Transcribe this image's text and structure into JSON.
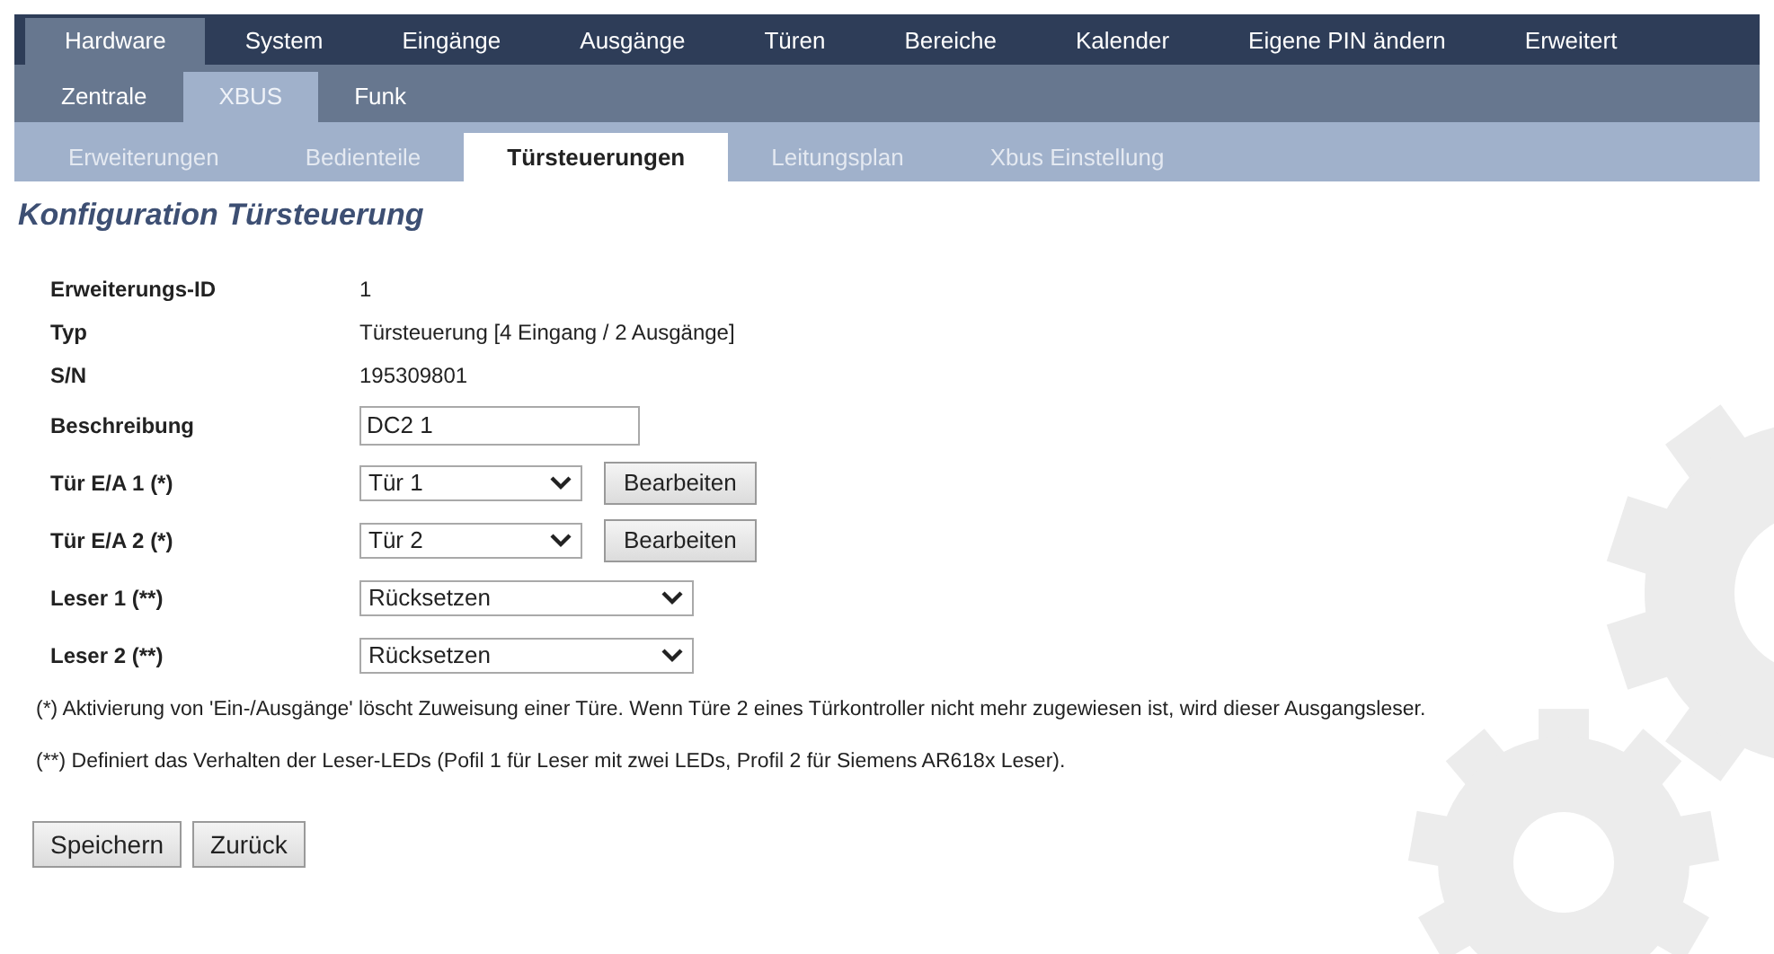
{
  "nav_main": [
    {
      "label": "Hardware",
      "selected": true
    },
    {
      "label": "System",
      "selected": false
    },
    {
      "label": "Eingänge",
      "selected": false
    },
    {
      "label": "Ausgänge",
      "selected": false
    },
    {
      "label": "Türen",
      "selected": false
    },
    {
      "label": "Bereiche",
      "selected": false
    },
    {
      "label": "Kalender",
      "selected": false
    },
    {
      "label": "Eigene PIN ändern",
      "selected": false
    },
    {
      "label": "Erweitert",
      "selected": false
    }
  ],
  "nav_sub": [
    {
      "label": "Zentrale",
      "selected": false
    },
    {
      "label": "XBUS",
      "selected": true
    },
    {
      "label": "Funk",
      "selected": false
    }
  ],
  "nav_tabs": [
    {
      "label": "Erweiterungen",
      "selected": false
    },
    {
      "label": "Bedienteile",
      "selected": false
    },
    {
      "label": "Türsteuerungen",
      "selected": true
    },
    {
      "label": "Leitungsplan",
      "selected": false
    },
    {
      "label": "Xbus Einstellung",
      "selected": false
    }
  ],
  "heading": "Konfiguration Türsteuerung",
  "fields": [
    {
      "kind": "text",
      "label": "Erweiterungs-ID",
      "value": "1"
    },
    {
      "kind": "text",
      "label": "Typ",
      "value": "Türsteuerung [4 Eingang / 2 Ausgänge]"
    },
    {
      "kind": "text",
      "label": "S/N",
      "value": "195309801"
    },
    {
      "kind": "input",
      "label": "Beschreibung",
      "value": "DC2 1"
    },
    {
      "kind": "select_button",
      "label": "Tür E/A 1 (*)",
      "value": "Tür 1",
      "button": "Bearbeiten"
    },
    {
      "kind": "select_button",
      "label": "Tür E/A 2 (*)",
      "value": "Tür 2",
      "button": "Bearbeiten"
    },
    {
      "kind": "select",
      "label": "Leser 1 (**)",
      "value": "Rücksetzen"
    },
    {
      "kind": "select",
      "label": "Leser 2 (**)",
      "value": "Rücksetzen"
    }
  ],
  "notes": [
    "(*) Aktivierung von 'Ein-/Ausgänge' löscht Zuweisung einer Türe. Wenn Türe 2 eines Türkontroller nicht mehr zugewiesen ist, wird dieser Ausgangsleser.",
    "(**) Definiert das Verhalten der Leser-LEDs (Pofil 1 für Leser mit zwei LEDs, Profil 2 für Siemens AR618x Leser)."
  ],
  "buttons": [
    "Speichern",
    "Zurück"
  ]
}
